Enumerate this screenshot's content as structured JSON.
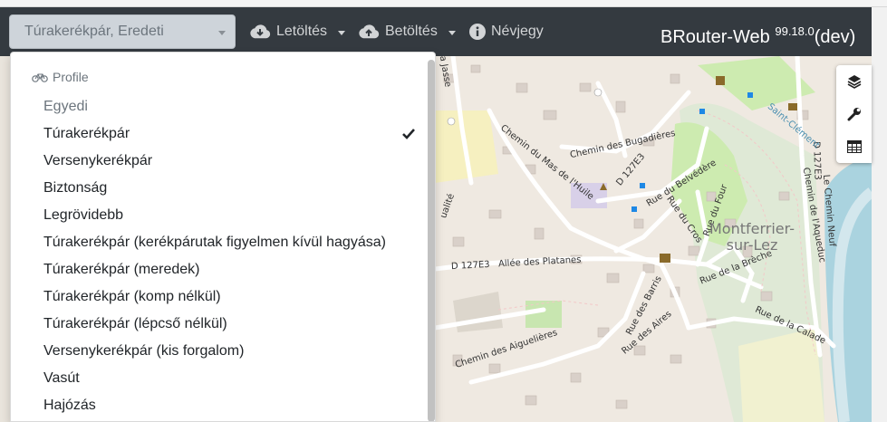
{
  "navbar": {
    "profile_select": {
      "value": "Túrakerékpár, Eredeti"
    },
    "download": {
      "label": "Letöltés",
      "icon": "cloud-download-icon"
    },
    "upload": {
      "label": "Betöltés",
      "icon": "cloud-upload-icon"
    },
    "about": {
      "label": "Névjegy",
      "icon": "info-circle-icon"
    },
    "brand": {
      "name": "BRouter-Web",
      "version": "99.18.0",
      "suffix": "(dev)"
    }
  },
  "profile_menu": {
    "header": "Profile",
    "header_icon": "bicycle-icon",
    "items": [
      {
        "label": "Egyedi",
        "muted": true,
        "selected": false
      },
      {
        "label": "Túrakerékpár",
        "muted": false,
        "selected": true
      },
      {
        "label": "Versenykerékpár",
        "muted": false,
        "selected": false
      },
      {
        "label": "Biztonság",
        "muted": false,
        "selected": false
      },
      {
        "label": "Legrövidebb",
        "muted": false,
        "selected": false
      },
      {
        "label": "Túrakerékpár (kerékpárutak figyelmen kívül hagyása)",
        "muted": false,
        "selected": false
      },
      {
        "label": "Túrakerékpár (meredek)",
        "muted": false,
        "selected": false
      },
      {
        "label": "Túrakerékpár (komp nélkül)",
        "muted": false,
        "selected": false
      },
      {
        "label": "Túrakerékpár (lépcső nélkül)",
        "muted": false,
        "selected": false
      },
      {
        "label": "Versenykerékpár (kis forgalom)",
        "muted": false,
        "selected": false
      },
      {
        "label": "Vasút",
        "muted": false,
        "selected": false
      },
      {
        "label": "Hajózás",
        "muted": false,
        "selected": false
      }
    ]
  },
  "map": {
    "town": "Montferrier-\nsur-Lez",
    "streets": {
      "chemin_des_bugadieres": "Chemin des Bugadières",
      "chemin_du_mas_de_lhuile": "Chemin du Mas de l'Huile",
      "d127e3_a": "D 127E3",
      "rue_du_belvedere": "Rue du Belvédère",
      "d127e3_b": "D 127E3",
      "allee_des_platanes": "Allée des Platanes",
      "rue_du_four": "Rue du Four",
      "rue_du_cros": "Rue du Cros",
      "rue_de_la_breche": "Rue de la Brèche",
      "rue_des_barris": "Rue des Barris",
      "rue_des_aires": "Rue des Aires",
      "chemin_des_aiguelieres": "Chemin des Aiguelières",
      "rue_de_la_calade": "Rue de la Calade",
      "chemin_de_laqueduc": "Chemin de l'Aqueduc",
      "le_chemin_neuf": "Le Chemin Neuf",
      "d127e3_c": "D 127E3",
      "saint_clement": "Saint-Clément",
      "fragment_jasse": "la Jasse",
      "fragment_ualite": "ualité"
    },
    "controls": [
      "layers-icon",
      "wrench-icon",
      "table-icon"
    ]
  }
}
